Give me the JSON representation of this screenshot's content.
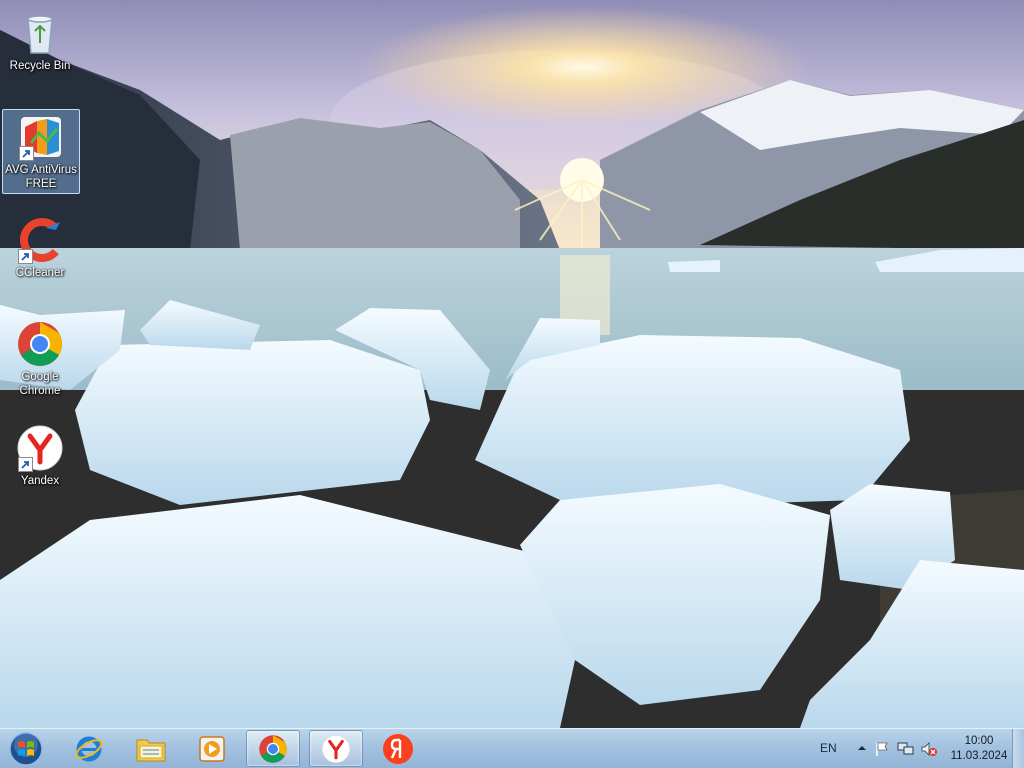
{
  "desktop": {
    "icons": [
      {
        "label": "Recycle Bin",
        "icon": "recycle-bin-icon"
      },
      {
        "label": "AVG AntiVirus FREE",
        "icon": "avg-antivirus-icon"
      },
      {
        "label": "CCleaner",
        "icon": "ccleaner-icon"
      },
      {
        "label": "Google Chrome",
        "icon": "chrome-icon"
      },
      {
        "label": "Yandex",
        "icon": "yandex-browser-icon"
      }
    ],
    "selected": "AVG AntiVirus FREE"
  },
  "taskbar": {
    "start": "start-orb-icon",
    "pinned": [
      {
        "icon": "internet-explorer-icon"
      },
      {
        "icon": "file-explorer-icon"
      },
      {
        "icon": "media-player-icon"
      },
      {
        "icon": "chrome-icon",
        "active": true
      },
      {
        "icon": "yandex-browser-icon",
        "active": true
      },
      {
        "icon": "yandex-ya-icon"
      }
    ]
  },
  "tray": {
    "language": "EN",
    "icons": [
      "chevron-up-icon",
      "action-center-flag-icon",
      "network-icon",
      "volume-muted-icon"
    ],
    "time": "10:00",
    "date": "11.03.2024"
  },
  "colors": {
    "taskbar": "#a4c2e0",
    "sky": "#c9c3df",
    "water": "#9fc0ce",
    "ice": "#e6f2fb"
  }
}
